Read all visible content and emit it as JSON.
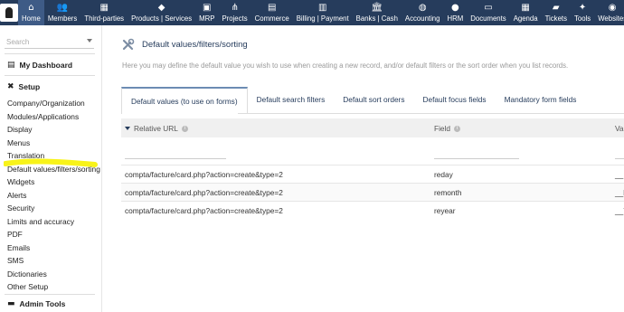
{
  "nav": {
    "items": [
      {
        "label": "Home",
        "icon": "home-icon",
        "glyph": "⌂",
        "active": true
      },
      {
        "label": "Members",
        "icon": "members-icon",
        "glyph": "👥"
      },
      {
        "label": "Third-parties",
        "icon": "building-icon",
        "glyph": "▦"
      },
      {
        "label": "Products | Services",
        "icon": "cube-icon",
        "glyph": "◆"
      },
      {
        "label": "MRP",
        "icon": "cubes-icon",
        "glyph": "▣"
      },
      {
        "label": "Projects",
        "icon": "sitemap-icon",
        "glyph": "⋔"
      },
      {
        "label": "Commerce",
        "icon": "suitcase-icon",
        "glyph": "▤"
      },
      {
        "label": "Billing | Payment",
        "icon": "invoice-icon",
        "glyph": "▥"
      },
      {
        "label": "Banks | Cash",
        "icon": "bank-icon",
        "glyph": "🏛"
      },
      {
        "label": "Accounting",
        "icon": "accounting-icon",
        "glyph": "◍"
      },
      {
        "label": "HRM",
        "icon": "user-tie-icon",
        "glyph": "●"
      },
      {
        "label": "Documents",
        "icon": "folder-icon",
        "glyph": "▭"
      },
      {
        "label": "Agenda",
        "icon": "calendar-icon",
        "glyph": "▦"
      },
      {
        "label": "Tickets",
        "icon": "ticket-icon",
        "glyph": "▰"
      },
      {
        "label": "Tools",
        "icon": "wrench-icon",
        "glyph": "✦"
      },
      {
        "label": "Websites",
        "icon": "globe-icon",
        "glyph": "◉"
      }
    ]
  },
  "sidebar": {
    "search_placeholder": "Search",
    "dashboard_label": "My Dashboard",
    "setup_label": "Setup",
    "items": [
      "Company/Organization",
      "Modules/Applications",
      "Display",
      "Menus",
      "Translation",
      "Default values/filters/sorting",
      "Widgets",
      "Alerts",
      "Security",
      "Limits and accuracy",
      "PDF",
      "Emails",
      "SMS",
      "Dictionaries",
      "Other Setup"
    ],
    "admin_tools_label": "Admin Tools",
    "highlight_color": "#f7f200"
  },
  "main": {
    "title": "Default values/filters/sorting",
    "description": "Here you may define the default value you wish to use when creating a new record, and/or default filters or the sort order when you list records.",
    "tabs": [
      {
        "label": "Default values (to use on forms)",
        "active": true
      },
      {
        "label": "Default search filters"
      },
      {
        "label": "Default sort orders"
      },
      {
        "label": "Default focus fields"
      },
      {
        "label": "Mandatory form fields"
      }
    ],
    "table": {
      "columns": [
        "Relative URL",
        "Field",
        "Val"
      ],
      "rows": [
        {
          "url": "compta/facture/card.php?action=create&type=2",
          "field": "reday",
          "value": "__"
        },
        {
          "url": "compta/facture/card.php?action=create&type=2",
          "field": "remonth",
          "value": "__l"
        },
        {
          "url": "compta/facture/card.php?action=create&type=2",
          "field": "reyear",
          "value": "__Y"
        }
      ]
    }
  },
  "colors": {
    "topbar": "#263c5c",
    "accent": "#6c8cb3"
  }
}
